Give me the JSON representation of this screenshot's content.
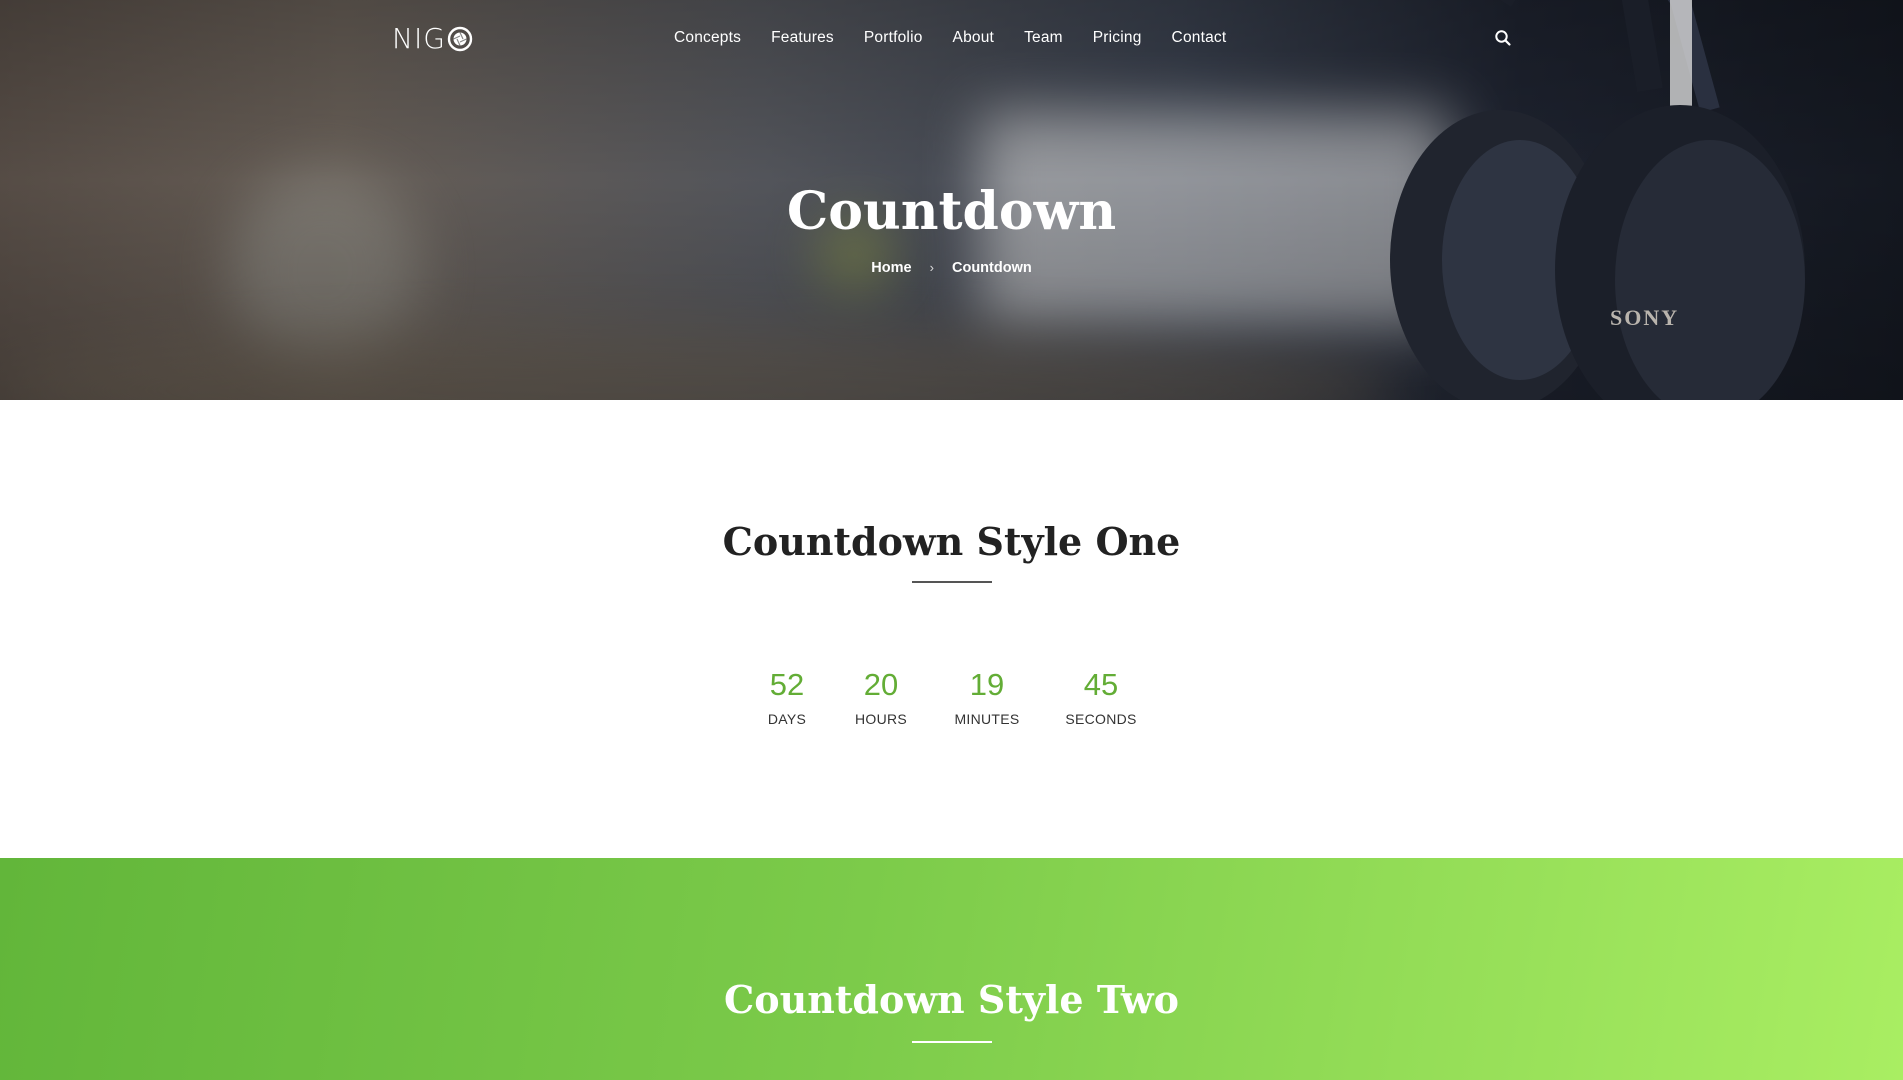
{
  "brand": {
    "logo_text": "NIG",
    "logo_icon": "aperture-o-icon"
  },
  "nav": {
    "items": [
      "Concepts",
      "Features",
      "Portfolio",
      "About",
      "Team",
      "Pricing",
      "Contact"
    ],
    "search_icon": "search-icon"
  },
  "hero": {
    "title": "Countdown",
    "breadcrumb": {
      "home": "Home",
      "separator": "›",
      "current": "Countdown"
    },
    "background": "blurred desk with monitor, mug and headphones"
  },
  "section_one": {
    "title": "Countdown Style One",
    "countdown": [
      {
        "value": "52",
        "label": "DAYS"
      },
      {
        "value": "20",
        "label": "HOURS"
      },
      {
        "value": "19",
        "label": "MINUTES"
      },
      {
        "value": "45",
        "label": "SECONDS"
      }
    ]
  },
  "section_two": {
    "title": "Countdown Style Two"
  },
  "colors": {
    "accent_green": "#63ad36",
    "gradient_start": "#62b63a",
    "gradient_end": "#a9ee62",
    "heading_dark": "#222222",
    "white": "#ffffff"
  }
}
